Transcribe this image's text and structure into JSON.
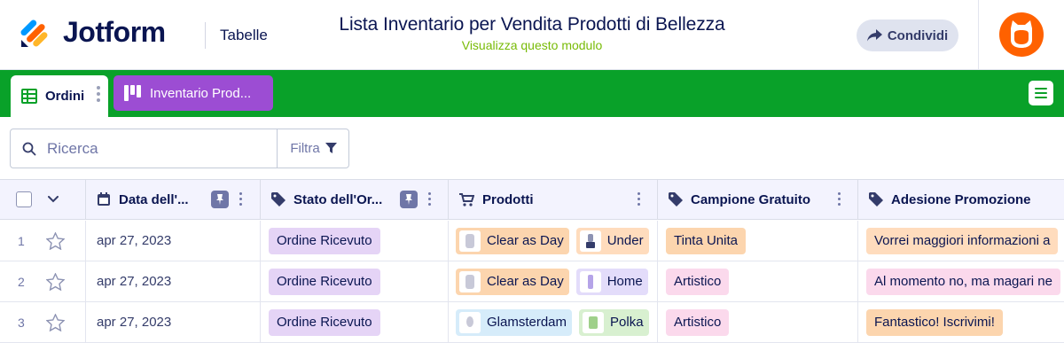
{
  "brand": {
    "name": "Jotform"
  },
  "header": {
    "section": "Tabelle",
    "title": "Lista Inventario per Vendita Prodotti di Bellezza",
    "subtitle": "Visualizza questo modulo",
    "share_label": "Condividi"
  },
  "tabs": [
    {
      "label": "Ordini",
      "icon": "table-icon",
      "active": true
    },
    {
      "label": "Inventario Prod...",
      "icon": "board-icon",
      "active": false
    }
  ],
  "search": {
    "placeholder": "Ricerca",
    "filter_label": "Filtra"
  },
  "columns": [
    {
      "label": "Data dell'...",
      "icon": "calendar-icon"
    },
    {
      "label": "Stato dell'Or...",
      "icon": "tag-icon"
    },
    {
      "label": "Prodotti",
      "icon": "cart-icon"
    },
    {
      "label": "Campione Gratuito",
      "icon": "tag-icon"
    },
    {
      "label": "Adesione Promozione",
      "icon": "tag-icon"
    }
  ],
  "rows": [
    {
      "num": "1",
      "date": "apr 27, 2023",
      "status": "Ordine Ricevuto",
      "products": [
        {
          "name": "Clear as Day",
          "color": "#fcd5ae"
        },
        {
          "name": "Under",
          "color": "#ffdcbd"
        }
      ],
      "sample": {
        "label": "Tinta Unita",
        "color": "#fcd5ae"
      },
      "promo": {
        "label": "Vorrei maggiori informazioni a",
        "color": "#ffdcbd"
      }
    },
    {
      "num": "2",
      "date": "apr 27, 2023",
      "status": "Ordine Ricevuto",
      "products": [
        {
          "name": "Clear as Day",
          "color": "#fcd5ae"
        },
        {
          "name": "Home",
          "color": "#e3dcfa"
        }
      ],
      "sample": {
        "label": "Artistico",
        "color": "#fbd9ec"
      },
      "promo": {
        "label": "Al momento no, ma magari ne",
        "color": "#fbd9ec"
      }
    },
    {
      "num": "3",
      "date": "apr 27, 2023",
      "status": "Ordine Ricevuto",
      "products": [
        {
          "name": "Glamsterdam",
          "color": "#d6ecfa"
        },
        {
          "name": "Polka",
          "color": "#d8f0d0"
        }
      ],
      "sample": {
        "label": "Artistico",
        "color": "#fbd9ec"
      },
      "promo": {
        "label": "Fantastico! Iscrivimi!",
        "color": "#fcd5ae"
      }
    }
  ],
  "colors": {
    "brand_green": "#09a129",
    "tab_purple": "#9c4dd3",
    "status_purple": "#e5d4f6",
    "avatar_orange": "#ff6100"
  }
}
